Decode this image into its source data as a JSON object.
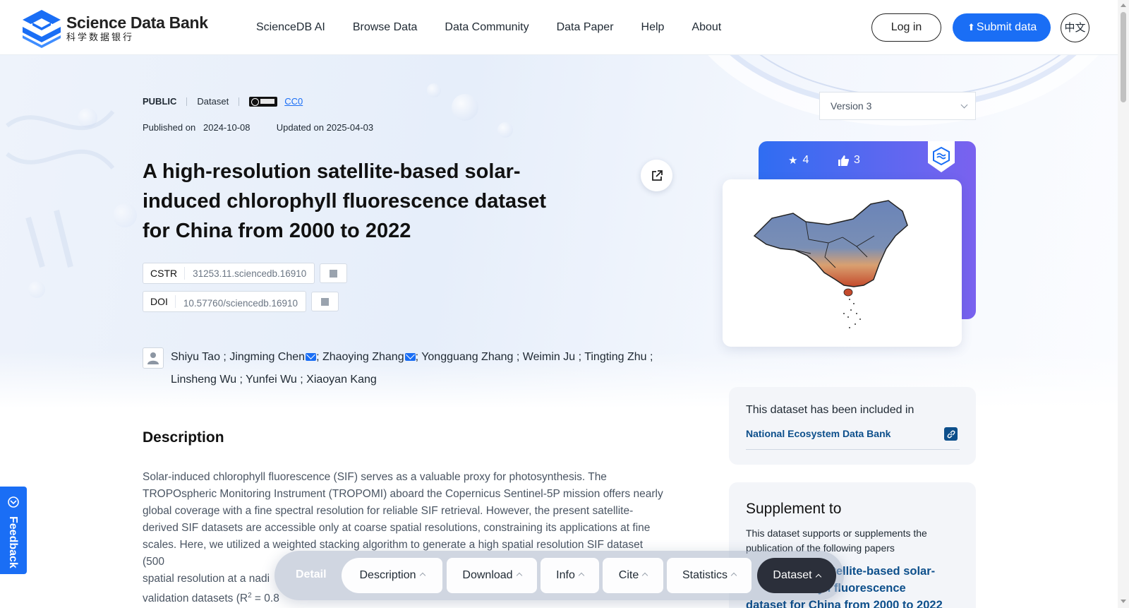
{
  "brand": {
    "name": "Science Data Bank",
    "subtitle": "科学数据银行",
    "accent_color": "#1a6ef5"
  },
  "nav": {
    "items": [
      "ScienceDB AI",
      "Browse Data",
      "Data Community",
      "Data Paper",
      "Help",
      "About"
    ],
    "login_label": "Log in",
    "submit_label": "Submit data",
    "language_label": "中文"
  },
  "dataset": {
    "visibility": "PUBLIC",
    "type": "Dataset",
    "license": "CC0",
    "published_label": "Published on",
    "published_date": "2024-10-08",
    "updated_label": "Updated on",
    "updated_date": "2025-04-03",
    "title": "A high-resolution satellite-based solar-induced chlorophyll fluorescence dataset for China from 2000 to 2022",
    "cstr_label": "CSTR",
    "cstr_value": "31253.11.sciencedb.16910",
    "doi_label": "DOI",
    "doi_value": "10.57760/sciencedb.16910",
    "authors": [
      {
        "name": "Shiyu Tao",
        "email": false
      },
      {
        "name": "Jingming Chen",
        "email": true
      },
      {
        "name": "Zhaoying Zhang",
        "email": true
      },
      {
        "name": "Yongguang Zhang",
        "email": false
      },
      {
        "name": "Weimin Ju",
        "email": false
      },
      {
        "name": "Tingting Zhu",
        "email": false
      },
      {
        "name": "Linsheng Wu",
        "email": false
      },
      {
        "name": "Yunfei Wu",
        "email": false
      },
      {
        "name": "Xiaoyan Kang",
        "email": false
      }
    ]
  },
  "description": {
    "heading": "Description",
    "text": "Solar-induced chlorophyll fluorescence (SIF) serves as a valuable proxy for photosynthesis. The TROPOspheric Monitoring Instrument (TROPOMI) aboard the Copernicus Sentinel-5P mission offers nearly global coverage with a fine spectral resolution for reliable SIF retrieval. However, the present satellite-derived SIF datasets are accessible only at coarse spatial resolutions, constraining its applications at fine scales. Here, we utilized a weighted stacking algorithm to generate a high spatial resolution SIF dataset (500",
    "line6": "spatial resolution at a nadi",
    "line7_prefix": "validation datasets (R",
    "line7_sup": "2",
    "line7_suffix": " = 0.8"
  },
  "sidebar": {
    "version_label": "Version 3",
    "stars": "4",
    "likes": "3",
    "included_title": "This dataset has been included in",
    "included_link": "National Ecosystem Data Bank",
    "supplement_title": "Supplement to",
    "supplement_desc": "This dataset supports or supplements the publication of the following papers",
    "supplement_line1": "satellite-based solar-",
    "supplement_line2": "yll fluorescence",
    "supplement_line3": "dataset for China from 2000 to 2022"
  },
  "tabbar": {
    "detail_label": "Detail",
    "tabs": [
      "Description",
      "Download",
      "Info",
      "Cite",
      "Statistics",
      "Dataset"
    ],
    "active_tab": "Dataset"
  },
  "feedback_label": "Feedback"
}
